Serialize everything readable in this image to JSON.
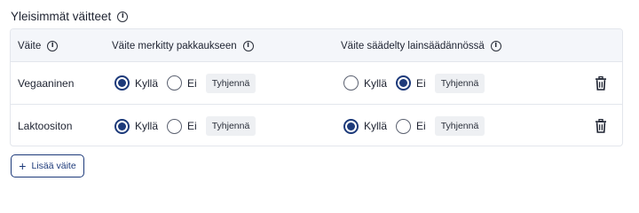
{
  "section": {
    "title": "Yleisimmät väitteet"
  },
  "table": {
    "headers": {
      "claim": "Väite",
      "marked": "Väite merkitty pakkaukseen",
      "regulated": "Väite säädelty lainsäädännössä"
    },
    "option_labels": {
      "yes": "Kyllä",
      "no": "Ei",
      "clear": "Tyhjennä"
    },
    "rows": [
      {
        "name": "Vegaaninen",
        "marked": "Kyllä",
        "regulated": "Ei"
      },
      {
        "name": "Laktoositon",
        "marked": "Kyllä",
        "regulated": "Kyllä"
      }
    ]
  },
  "add_button": {
    "label": "Lisää väite",
    "icon": "plus-icon"
  },
  "icons": {
    "info": "info-icon",
    "delete": "trash-icon"
  },
  "colors": {
    "accent": "#1d3a7a",
    "header_bg": "#f4f6fa",
    "border": "#e3e6ec"
  }
}
